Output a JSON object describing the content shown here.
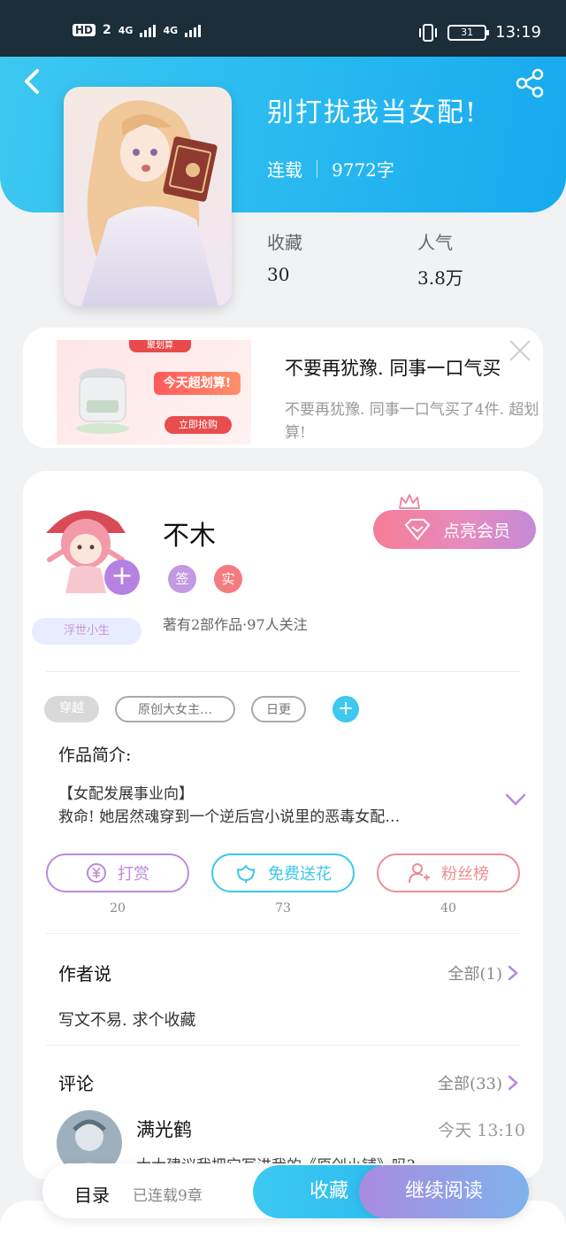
{
  "status_bar": {
    "hd": "HD",
    "sim": "2",
    "net1": "4G",
    "net2": "4G",
    "battery": "31",
    "time": "13:19"
  },
  "book": {
    "title": "别打扰我当女配!",
    "status": "连载",
    "word_count": "9772字",
    "favorites_label": "收藏",
    "favorites_value": "30",
    "popularity_label": "人气",
    "popularity_value": "3.8万"
  },
  "ad": {
    "title": "不要再犹豫. 同事一口气买",
    "desc": "不要再犹豫. 同事一口气买了4件. 超划算!",
    "image_texts": [
      "聚划算",
      "今天超划算!",
      "立即抢购"
    ]
  },
  "author": {
    "name": "不木",
    "tag": "浮世小生",
    "badges": [
      "签",
      "实"
    ],
    "works": "著有2部作品·97人关注",
    "vip_label": "点亮会员"
  },
  "tags": [
    "穿越",
    "原创大女主…",
    "日更"
  ],
  "intro": {
    "title": "作品简介:",
    "line1": "【女配发展事业向】",
    "line2": "救命! 她居然魂穿到一个逆后宫小说里的恶毒女配…"
  },
  "actions": [
    {
      "label": "打赏",
      "count": "20",
      "color": "#b98be0"
    },
    {
      "label": "免费送花",
      "count": "73",
      "color": "#3cc8ea"
    },
    {
      "label": "粉丝榜",
      "count": "40",
      "color": "#ec8e95"
    }
  ],
  "author_says": {
    "title": "作者说",
    "more": "全部(1)",
    "text": "写文不易. 求个收藏"
  },
  "comments": {
    "title": "评论",
    "more": "全部(33)",
    "first": {
      "user": "满光鹤",
      "time": "今天 13:10",
      "text": "大大建议我把它写进我的《原创小铺》吗?"
    }
  },
  "bottom": {
    "toc": "目录",
    "toc_sub": "已连载9章",
    "favorite": "收藏",
    "continue": "继续阅读"
  },
  "colors": {
    "header": "#26b7f0",
    "accent_purple": "#b582e2",
    "vip_pink": "#f57d97"
  }
}
